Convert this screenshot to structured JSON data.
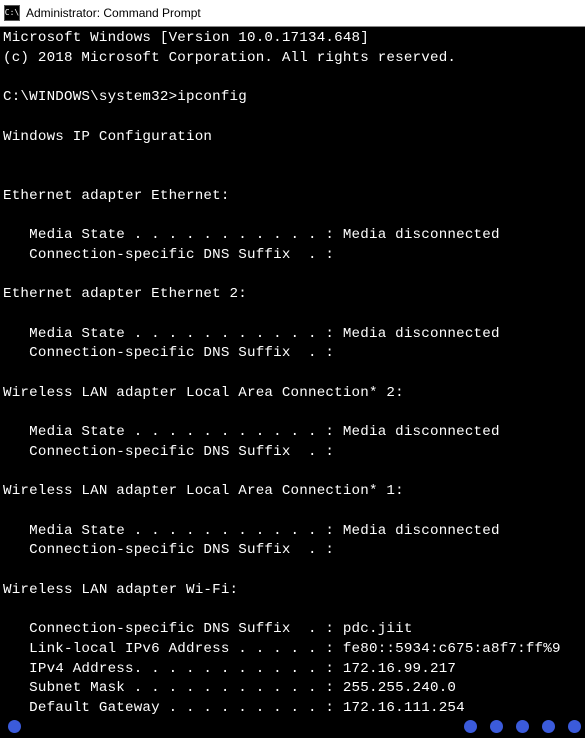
{
  "titlebar": {
    "icon_text": "C:\\",
    "title": "Administrator: Command Prompt"
  },
  "terminal": {
    "header_line1": "Microsoft Windows [Version 10.0.17134.648]",
    "header_line2": "(c) 2018 Microsoft Corporation. All rights reserved.",
    "prompt_line": "C:\\WINDOWS\\system32>ipconfig",
    "config_header": "Windows IP Configuration",
    "adapters": [
      {
        "title": "Ethernet adapter Ethernet:",
        "lines": [
          "   Media State . . . . . . . . . . . : Media disconnected",
          "   Connection-specific DNS Suffix  . :"
        ]
      },
      {
        "title": "Ethernet adapter Ethernet 2:",
        "lines": [
          "   Media State . . . . . . . . . . . : Media disconnected",
          "   Connection-specific DNS Suffix  . :"
        ]
      },
      {
        "title": "Wireless LAN adapter Local Area Connection* 2:",
        "lines": [
          "   Media State . . . . . . . . . . . : Media disconnected",
          "   Connection-specific DNS Suffix  . :"
        ]
      },
      {
        "title": "Wireless LAN adapter Local Area Connection* 1:",
        "lines": [
          "   Media State . . . . . . . . . . . : Media disconnected",
          "   Connection-specific DNS Suffix  . :"
        ]
      },
      {
        "title": "Wireless LAN adapter Wi-Fi:",
        "lines": [
          "   Connection-specific DNS Suffix  . : pdc.jiit",
          "   Link-local IPv6 Address . . . . . : fe80::5934:c675:a8f7:ff%9",
          "   IPv4 Address. . . . . . . . . . . : 172.16.99.217",
          "   Subnet Mask . . . . . . . . . . . : 255.255.240.0",
          "   Default Gateway . . . . . . . . . : 172.16.111.254"
        ]
      }
    ]
  }
}
